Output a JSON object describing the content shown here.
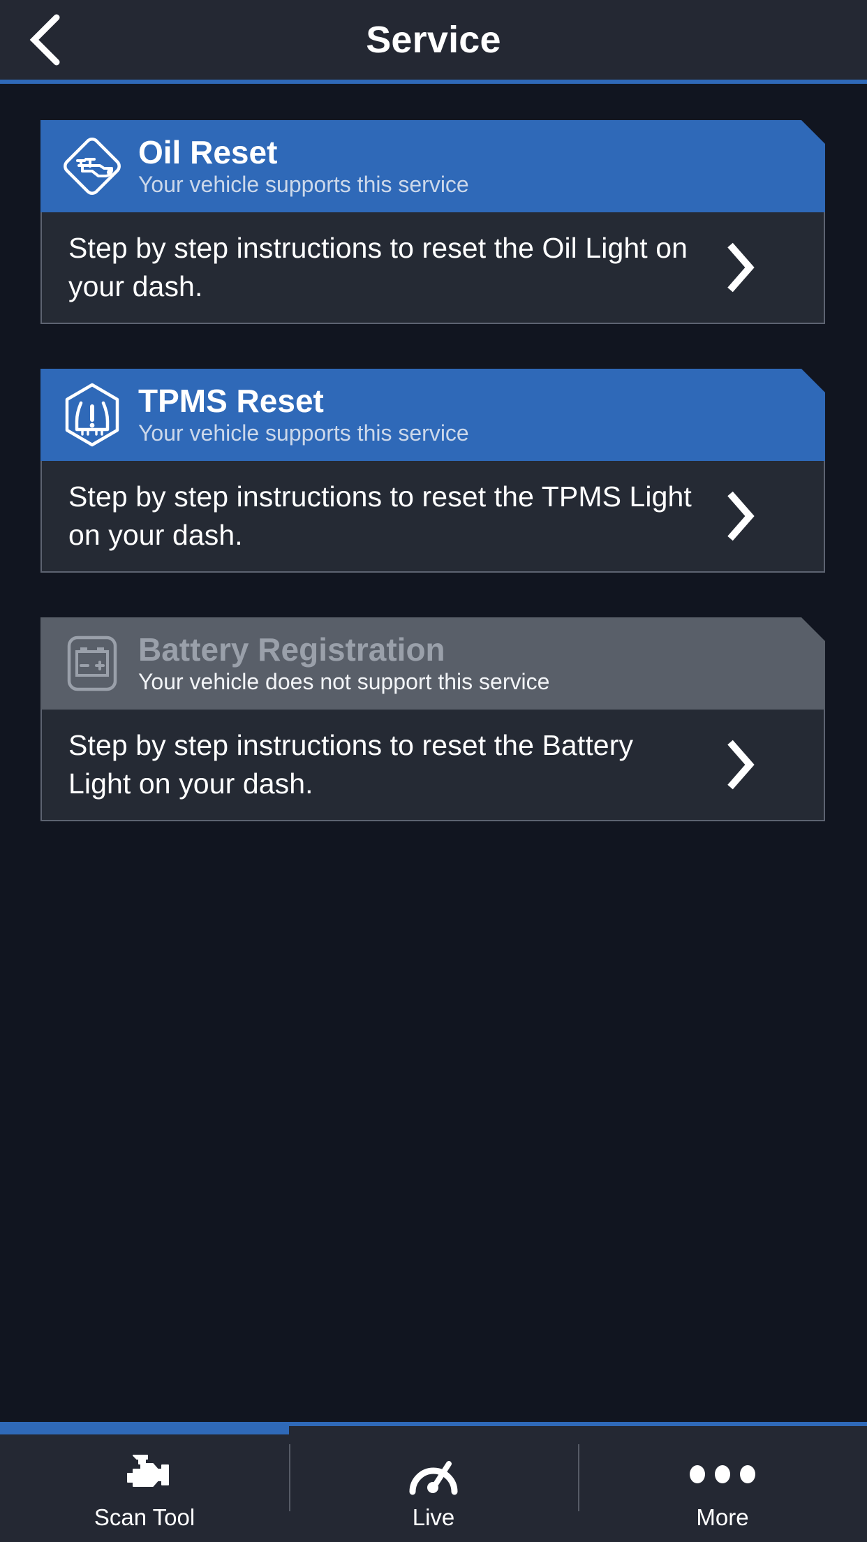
{
  "header": {
    "title": "Service",
    "back_icon": "chevron-left-icon"
  },
  "colors": {
    "accent_blue": "#2f69b8",
    "page_background": "#111520",
    "header_background": "#242833",
    "card_body_background": "#252a34",
    "card_border": "#5d6371",
    "disabled_banner": "#595f69",
    "text_primary": "#ffffff",
    "banner_subtitle": "#ccd8ea",
    "disabled_title": "#9aa0aa"
  },
  "services": [
    {
      "icon": "oil-can-diamond-icon",
      "title": "Oil Reset",
      "support_text": "Your vehicle supports this service",
      "description": "Step by step instructions to reset the Oil Light on your dash.",
      "arrow_icon": "chevron-right-icon",
      "supported": true
    },
    {
      "icon": "tpms-hexagon-icon",
      "title": "TPMS Reset",
      "support_text": "Your vehicle supports this service",
      "description": "Step by step instructions to reset the TPMS Light on your dash.",
      "arrow_icon": "chevron-right-icon",
      "supported": true
    },
    {
      "icon": "battery-icon",
      "title": "Battery Registration",
      "support_text": "Your vehicle does not support this service",
      "description": "Step by step instructions to reset the Battery Light on your dash.",
      "arrow_icon": "chevron-right-icon",
      "supported": false
    }
  ],
  "tabbar": {
    "active_index": 0,
    "tabs": [
      {
        "label": "Scan Tool",
        "icon": "check-engine-icon"
      },
      {
        "label": "Live",
        "icon": "gauge-icon"
      },
      {
        "label": "More",
        "icon": "ellipsis-icon"
      }
    ]
  }
}
